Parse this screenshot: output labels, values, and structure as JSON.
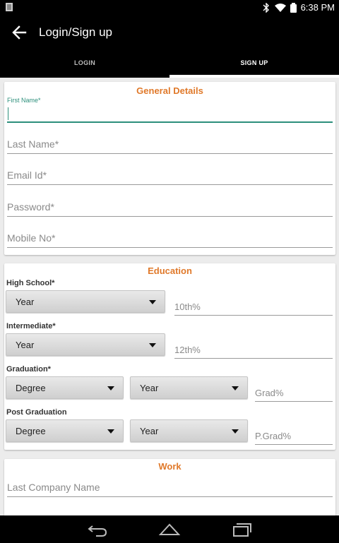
{
  "status_bar": {
    "time": "6:38 PM"
  },
  "app_bar": {
    "title": "Login/Sign up"
  },
  "tabs": [
    {
      "label": "LOGIN"
    },
    {
      "label": "SIGN UP"
    }
  ],
  "general": {
    "title": "General Details",
    "first_name_label": "First Name*",
    "last_name": "Last Name*",
    "email": "Email Id*",
    "password": "Password*",
    "mobile": "Mobile No*"
  },
  "education": {
    "title": "Education",
    "high_school": {
      "label": "High School*",
      "year": "Year",
      "percent": "10th%"
    },
    "intermediate": {
      "label": "Intermediate*",
      "year": "Year",
      "percent": "12th%"
    },
    "graduation": {
      "label": "Graduation*",
      "degree": "Degree",
      "year": "Year",
      "percent": "Grad%"
    },
    "post_graduation": {
      "label": "Post Graduation",
      "degree": "Degree",
      "year": "Year",
      "percent": "P.Grad%"
    }
  },
  "work": {
    "title": "Work",
    "last_company": "Last Company Name"
  },
  "colors": {
    "accent_orange": "#e0792a",
    "focus_teal": "#2c8f7b"
  }
}
